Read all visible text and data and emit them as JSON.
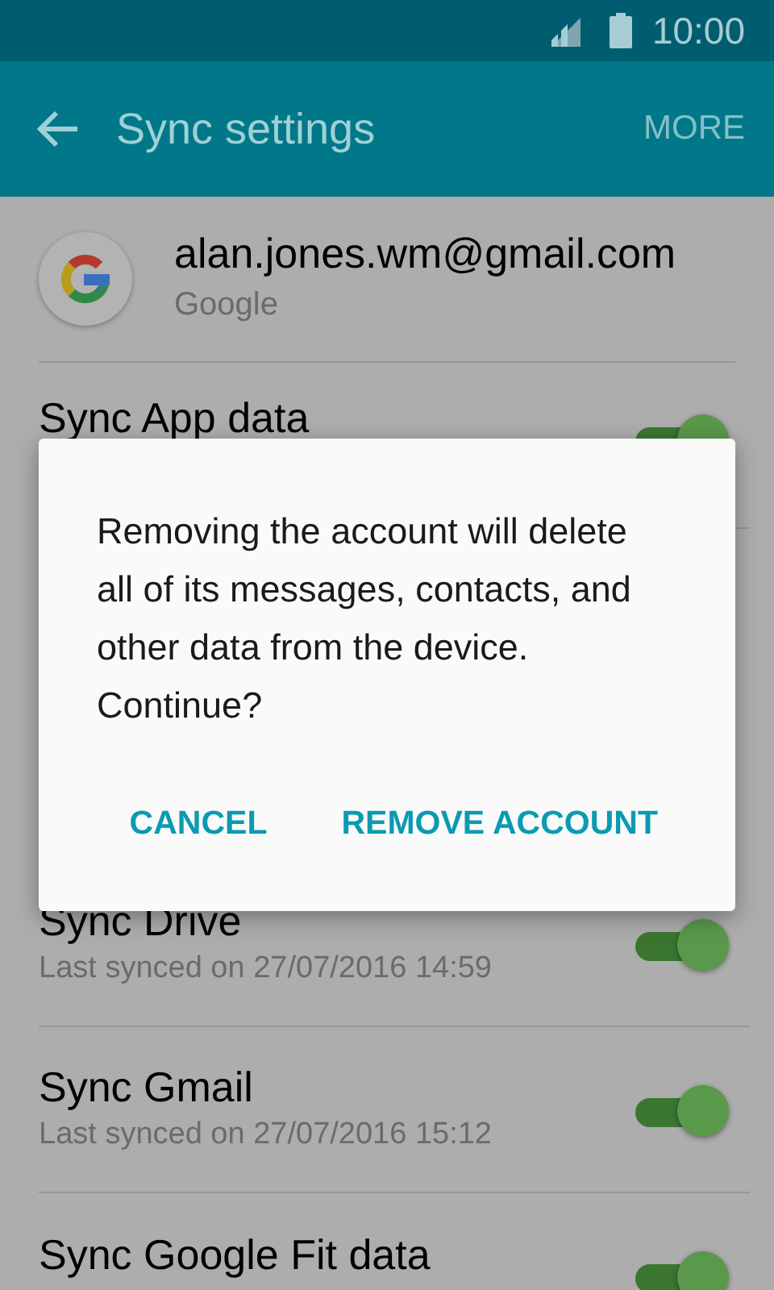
{
  "status_bar": {
    "time": "10:00"
  },
  "app_bar": {
    "title": "Sync settings",
    "action": "MORE"
  },
  "account": {
    "email": "alan.jones.wm@gmail.com",
    "type": "Google"
  },
  "sync_items": [
    {
      "title": "Sync App data",
      "on": true
    },
    {
      "title": "Sync Drive",
      "subtitle": "Last synced on 27/07/2016  14:59",
      "on": true
    },
    {
      "title": "Sync Gmail",
      "subtitle": "Last synced on 27/07/2016  15:12",
      "on": true
    },
    {
      "title": "Sync Google Fit data",
      "on": true
    }
  ],
  "dialog": {
    "message": "Removing the account will delete all of its messages, contacts, and other data from the device. Continue?",
    "buttons": [
      "CANCEL",
      "REMOVE ACCOUNT"
    ]
  }
}
